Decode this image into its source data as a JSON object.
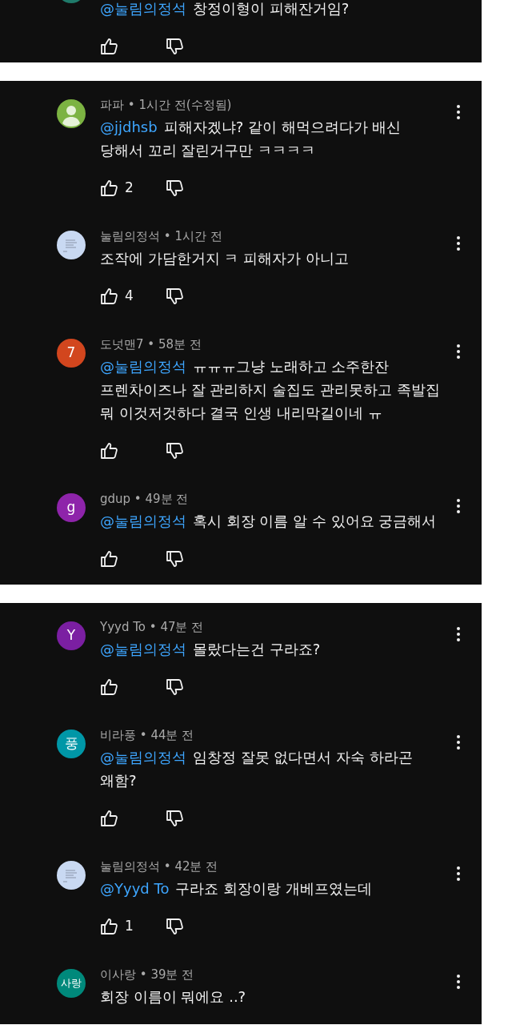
{
  "panels": [
    {
      "partial_top": true,
      "comments": [
        {
          "avatar": {
            "kind": "partial",
            "color": "#1f7a6a"
          },
          "mention": "@눌림의정석",
          "text": "창정이형이 피해잔거임?"
        }
      ]
    },
    {
      "comments": [
        {
          "avatar": {
            "kind": "default",
            "color": "#7cb342"
          },
          "byline": "파파 • 1시간 전(수정됨)",
          "mention": "@jjdhsb",
          "text": "피해자겠냐? 같이 해먹으려다가 배신 당해서 꼬리 잘린거구만 ㅋㅋㅋㅋ",
          "likes": "2"
        },
        {
          "avatar": {
            "kind": "image",
            "color": "#c9d9f2"
          },
          "byline": "눌림의정석 • 1시간 전",
          "text": "조작에 가담한거지 ㅋ 피해자가 아니고",
          "likes": "4"
        },
        {
          "avatar": {
            "kind": "letter",
            "color": "#d2461e",
            "letter": "7"
          },
          "byline": "도넛맨7 • 58분 전",
          "mention": "@눌림의정석",
          "text": "ㅠㅠㅠ그냥 노래하고 소주한잔 프렌차이즈나 잘 관리하지 술집도 관리못하고 족발집 뭐 이것저것하다 결국 인생 내리막길이네 ㅠ"
        },
        {
          "avatar": {
            "kind": "letter",
            "color": "#8e24aa",
            "letter": "g"
          },
          "byline": "gdup • 49분 전",
          "mention": "@눌림의정석",
          "text": "혹시 회장 이름 알 수 있어요 궁금해서"
        }
      ]
    },
    {
      "comments": [
        {
          "avatar": {
            "kind": "letter",
            "color": "#7b1fa2",
            "letter": "Y"
          },
          "byline": "Yyyd To • 47분 전",
          "mention": "@눌림의정석",
          "text": "몰랐다는건 구라죠?"
        },
        {
          "avatar": {
            "kind": "letter",
            "color": "#0097a7",
            "letter": "풍"
          },
          "byline": "비라풍 • 44분 전",
          "mention": "@눌림의정석",
          "text": "임창정 잘못 없다면서 자숙 하라곤 왜함?"
        },
        {
          "avatar": {
            "kind": "image",
            "color": "#c9d9f2"
          },
          "byline": "눌림의정석 • 42분 전",
          "mention": "@Yyyd To",
          "text": "구라죠 회장이랑 개베프였는데",
          "likes": "1"
        },
        {
          "avatar": {
            "kind": "letter",
            "color": "#00897b",
            "letter": "사랑"
          },
          "byline": "이사랑 • 39분 전",
          "text": "회장 이름이 뭐에요 ..?",
          "cut_off": true
        }
      ]
    }
  ]
}
